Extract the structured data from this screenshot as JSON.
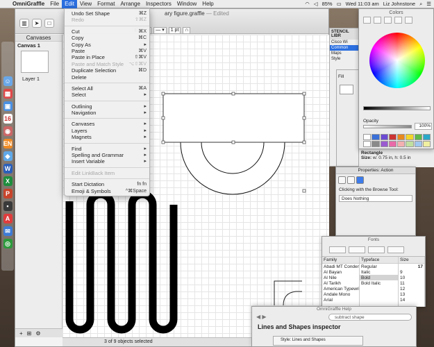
{
  "menubar": {
    "app": "OmniGraffle",
    "items": [
      "File",
      "Edit",
      "View",
      "Format",
      "Arrange",
      "Inspectors",
      "Window",
      "Help"
    ],
    "battery": "85%",
    "clock": "Wed 11:03 am",
    "user": "Liz Johnstone"
  },
  "window": {
    "title_prefix": "ary figure.graffle",
    "title_edited": "— Edited"
  },
  "sidebar": {
    "header": "Canvases",
    "canvas_name": "Canvas 1",
    "layer_name": "Layer 1"
  },
  "toolbar": {
    "line_width": "1 pt"
  },
  "statusbar": {
    "selection": "3 of 9 objects selected"
  },
  "edit_menu": {
    "groups": [
      [
        {
          "label": "Undo Set Shape",
          "shortcut": "⌘Z",
          "enabled": true
        },
        {
          "label": "Redo",
          "shortcut": "⇧⌘Z",
          "enabled": false
        }
      ],
      [
        {
          "label": "Cut",
          "shortcut": "⌘X",
          "enabled": true
        },
        {
          "label": "Copy",
          "shortcut": "⌘C",
          "enabled": true
        },
        {
          "label": "Copy As",
          "shortcut": "▸",
          "enabled": true
        },
        {
          "label": "Paste",
          "shortcut": "⌘V",
          "enabled": true
        },
        {
          "label": "Paste in Place",
          "shortcut": "⇧⌘V",
          "enabled": true
        },
        {
          "label": "Paste and Match Style",
          "shortcut": "⌥⇧⌘V",
          "enabled": false
        },
        {
          "label": "Duplicate Selection",
          "shortcut": "⌘D",
          "enabled": true
        },
        {
          "label": "Delete",
          "shortcut": "",
          "enabled": true
        }
      ],
      [
        {
          "label": "Select All",
          "shortcut": "⌘A",
          "enabled": true
        },
        {
          "label": "Select",
          "shortcut": "▸",
          "enabled": true
        }
      ],
      [
        {
          "label": "Outlining",
          "shortcut": "▸",
          "enabled": true
        },
        {
          "label": "Navigation",
          "shortcut": "▸",
          "enabled": true
        }
      ],
      [
        {
          "label": "Canvases",
          "shortcut": "▸",
          "enabled": true
        },
        {
          "label": "Layers",
          "shortcut": "▸",
          "enabled": true
        },
        {
          "label": "Magnets",
          "shortcut": "▸",
          "enabled": true
        }
      ],
      [
        {
          "label": "Find",
          "shortcut": "▸",
          "enabled": true
        },
        {
          "label": "Spelling and Grammar",
          "shortcut": "▸",
          "enabled": true
        },
        {
          "label": "Insert Variable",
          "shortcut": "▸",
          "enabled": true
        }
      ],
      [
        {
          "label": "Edit LinkBack Item",
          "shortcut": "",
          "enabled": false
        }
      ],
      [
        {
          "label": "Start Dictation",
          "shortcut": "fn fn",
          "enabled": true
        },
        {
          "label": "Emoji & Symbols",
          "shortcut": "^⌘Space",
          "enabled": true
        }
      ]
    ]
  },
  "stencil": {
    "header": "STENCIL LIBR",
    "items": [
      "Cisco Wi",
      "Common",
      "Maps",
      "Style"
    ]
  },
  "colors_panel": {
    "title": "Colors",
    "opacity_label": "Opacity",
    "opacity_value": "100%",
    "swatches": [
      "#ffffff",
      "#3a6fd8",
      "#6b4ad3",
      "#c33",
      "#e8891d",
      "#f3d52a",
      "#5fb84a",
      "#2aa8c9",
      "#ffffff",
      "#8a8a8a",
      "#9a5bd0",
      "#e86aa8",
      "#f4b0b0",
      "#c0e0a0",
      "#a0c8f0",
      "#f0f0a0"
    ]
  },
  "fill_inspector": {
    "label": "Fill"
  },
  "size_info": {
    "name": "Rectangle",
    "size_label": "Size:",
    "size_value": "w: 0.75 in, h: 0.5 in"
  },
  "properties_action": {
    "title": "Properties: Action",
    "caption": "Clicking with the Browse Tool:",
    "selected": "Does Nothing"
  },
  "fonts_panel": {
    "title": "Fonts",
    "family_header": "Family",
    "typeface_header": "Typeface",
    "size_header": "Size",
    "families": [
      "Abadi MT Conden",
      "Al Bayan",
      "Al Nile",
      "Al Tarikh",
      "American Typewri",
      "Andale Mono",
      "Arial"
    ],
    "typefaces": [
      "Regular",
      "Italic",
      "Bold",
      "Bold Italic"
    ],
    "selected_typeface": "Bold",
    "size_value": "17",
    "sizes": [
      "9",
      "10",
      "11",
      "12",
      "13",
      "14"
    ]
  },
  "help_panel": {
    "title": "OmniGraffle Help",
    "search_value": "subtract shape",
    "heading": "Lines and Shapes inspector",
    "sub": "Style: Lines and Shapes"
  }
}
